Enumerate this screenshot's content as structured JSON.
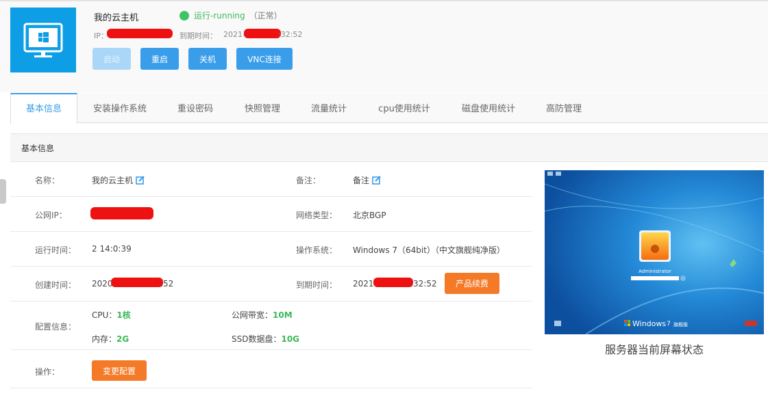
{
  "header": {
    "title": "我的云主机",
    "status_text": "运行-running",
    "status_normal": "（正常）",
    "ip_label": "IP：",
    "expire_label": "到期时间：",
    "expire_prefix": "2021-",
    "expire_suffix": ":32:52",
    "buttons": {
      "start": "启动",
      "restart": "重启",
      "shutdown": "关机",
      "vnc": "VNC连接"
    }
  },
  "tabs": [
    "基本信息",
    "安装操作系统",
    "重设密码",
    "快照管理",
    "流量统计",
    "cpu使用统计",
    "磁盘使用统计",
    "高防管理"
  ],
  "section_title": "基本信息",
  "info": {
    "name_label": "名称：",
    "name_value": "我的云主机",
    "remark_label": "备注：",
    "remark_value": "备注",
    "public_ip_label": "公网IP：",
    "network_label": "网络类型：",
    "network_value": "北京BGP",
    "uptime_label": "运行时间：",
    "uptime_value": "2 14:0:39",
    "os_label": "操作系统：",
    "os_value": "Windows 7（64bit）（中文旗舰纯净版）",
    "created_label": "创建时间：",
    "created_prefix": "2020",
    "created_suffix": ":52",
    "expire_label": "到期时间：",
    "expire_prefix": "2021-",
    "expire_suffix": ":32:52",
    "renew_button": "产品续费",
    "config_label": "配置信息：",
    "cpu_label": "CPU：",
    "cpu_value": "1核",
    "bandwidth_label": "公网带宽：",
    "bandwidth_value": "10M",
    "memory_label": "内存：",
    "memory_value": "2G",
    "ssd_label": "SSD数据盘：",
    "ssd_value": "10G",
    "ops_label": "操作：",
    "change_config_button": "变更配置"
  },
  "screen": {
    "caption": "服务器当前屏幕状态",
    "login_user": "Administrator",
    "windows_brand": "Windows",
    "windows_version": "7",
    "windows_edition": "旗舰版"
  },
  "colors": {
    "primary": "#3a9dea",
    "orange": "#f47a28",
    "green": "#3cb85c",
    "logo_bg": "#0d9ee6"
  }
}
